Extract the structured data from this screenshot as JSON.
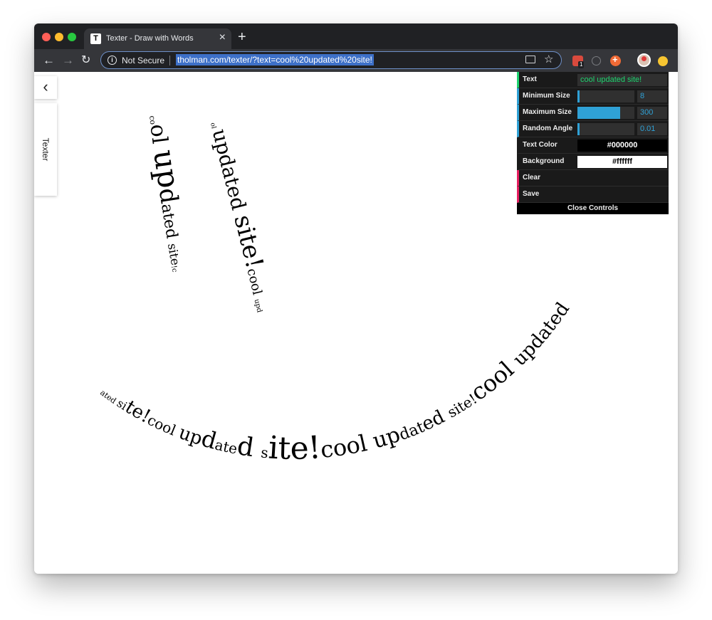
{
  "browser": {
    "tab_title": "Texter - Draw with Words",
    "tab_favicon": "T",
    "tab_close": "×",
    "new_tab": "+",
    "security_label": "Not Secure",
    "url": "tholman.com/texter/?text=cool%20updated%20site!",
    "extension_badge": "1",
    "icons": [
      "back-icon",
      "forward-icon",
      "reload-icon",
      "info-icon",
      "cast-icon",
      "star-icon",
      "extension-icon",
      "profile-avatar"
    ]
  },
  "sidebar": {
    "toggle": "‹",
    "tab_label": "Texter"
  },
  "controls": {
    "text_label": "Text",
    "text_value": "cool updated site!",
    "min_size_label": "Minimum Size",
    "min_size_value": "8",
    "min_size_fraction": 0.03,
    "max_size_label": "Maximum Size",
    "max_size_value": "300",
    "max_size_fraction": 0.75,
    "angle_label": "Random Angle",
    "angle_value": "0.01",
    "angle_fraction": 0.01,
    "text_color_label": "Text Color",
    "text_color_value": "#000000",
    "background_label": "Background",
    "background_value": "#ffffff",
    "clear_label": "Clear",
    "save_label": "Save",
    "close_label": "Close Controls"
  },
  "colors": {
    "accent": "#2fa1d6",
    "text_controller": "#1ed36f",
    "function_controller": "#e61d5f"
  },
  "canvas": {
    "stroke_left_eye": "cool updated site!c",
    "stroke_right_eye": "cool updated site!cool upd",
    "stroke_mouth": "ated site!cool updated site!cool updated site!cool updated site!co"
  }
}
